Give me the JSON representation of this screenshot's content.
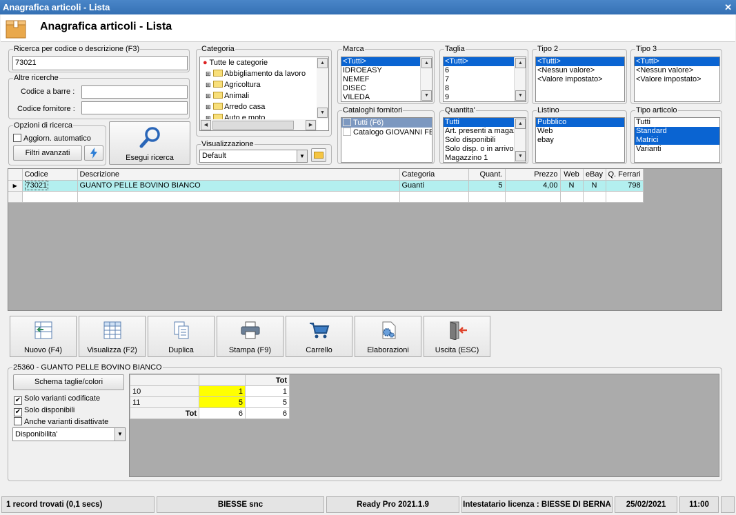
{
  "window": {
    "title": "Anagrafica articoli  - Lista",
    "heading": "Anagrafica articoli  - Lista"
  },
  "search": {
    "label": "Ricerca per codice o descrizione (F3)",
    "value": "73021"
  },
  "other_search": {
    "label": "Altre ricerche",
    "barcode_label": "Codice a barre :",
    "supplier_code_label": "Codice fornitore :",
    "barcode_value": "",
    "supplier_code_value": ""
  },
  "options": {
    "label": "Opzioni di ricerca",
    "auto_update": "Aggiorn. automatico",
    "advanced_filters": "Filtri avanzati"
  },
  "run_search": {
    "label": "Esegui ricerca"
  },
  "categoria": {
    "label": "Categoria",
    "items": [
      "Tutte le categorie",
      "Abbigliamento da lavoro",
      "Agricoltura",
      "Animali",
      "Arredo casa",
      "Auto e moto"
    ]
  },
  "visualizzazione": {
    "label": "Visualizzazione",
    "value": "Default"
  },
  "marca": {
    "label": "Marca",
    "items": [
      "<Tutti>",
      "IDROEASY",
      "NEMEF",
      "DISEC",
      "VILEDA"
    ]
  },
  "taglia": {
    "label": "Taglia",
    "items": [
      "<Tutti>",
      "6",
      "7",
      "8",
      "9"
    ]
  },
  "tipo2": {
    "label": "Tipo 2",
    "items": [
      "<Tutti>",
      "<Nessun valore>",
      "<Valore impostato>"
    ]
  },
  "tipo3": {
    "label": "Tipo 3",
    "items": [
      "<Tutti>",
      "<Nessun valore>",
      "<Valore impostato>"
    ]
  },
  "cataloghi": {
    "label": "Cataloghi fornitori",
    "items": [
      "Tutti (F6)",
      "Catalogo GIOVANNI FEI"
    ]
  },
  "quantita": {
    "label": "Quantita'",
    "items": [
      "Tutti",
      "Art. presenti a magaz",
      "Solo disponibili",
      "Solo disp. o in arrivo",
      "Magazzino 1"
    ]
  },
  "listino": {
    "label": "Listino",
    "items": [
      "Pubblico",
      "Web",
      "ebay"
    ]
  },
  "tipo_articolo": {
    "label": "Tipo articolo",
    "items": [
      "Tutti",
      "Standard",
      "Matrici",
      "Varianti"
    ]
  },
  "grid": {
    "columns": [
      "Codice",
      "Descrizione",
      "Categoria",
      "Quant.",
      "Prezzo",
      "Web",
      "eBay",
      "Q. Ferrari"
    ],
    "rows": [
      [
        "73021",
        "GUANTO PELLE BOVINO BIANCO",
        "Guanti",
        "5",
        "4,00",
        "N",
        "N",
        "798"
      ]
    ]
  },
  "toolbar": {
    "nuovo": "Nuovo (F4)",
    "visualizza": "Visualizza (F2)",
    "duplica": "Duplica",
    "stampa": "Stampa (F9)",
    "carrello": "Carrello",
    "elaborazioni": "Elaborazioni",
    "uscita": "Uscita (ESC)"
  },
  "detail": {
    "label": "25360 - GUANTO PELLE BOVINO BIANCO",
    "schema_button": "Schema taglie/colori",
    "solo_codificate": "Solo varianti codificate",
    "solo_disponibili": "Solo disponibili",
    "anche_disattivate": "Anche varianti disattivate",
    "dropdown": "Disponibilita'",
    "pivot": {
      "header_tot": "Tot",
      "rows": [
        [
          "10",
          "1",
          "1"
        ],
        [
          "11",
          "5",
          "5"
        ]
      ],
      "total_label": "Tot",
      "totals": [
        "6",
        "6"
      ]
    }
  },
  "status": {
    "records": "1 record trovati (0,1 secs)",
    "company": "BIESSE snc",
    "product": "Ready Pro 2021.1.9",
    "license": "Intestatario licenza : BIESSE DI BERNA",
    "date": "25/02/2021",
    "time": "11:00"
  },
  "colors": {
    "title_bar": "#3a78bd",
    "selection": "#0a64d2",
    "row_highlight": "#b3efef",
    "pivot_yellow": "#ffff00"
  }
}
